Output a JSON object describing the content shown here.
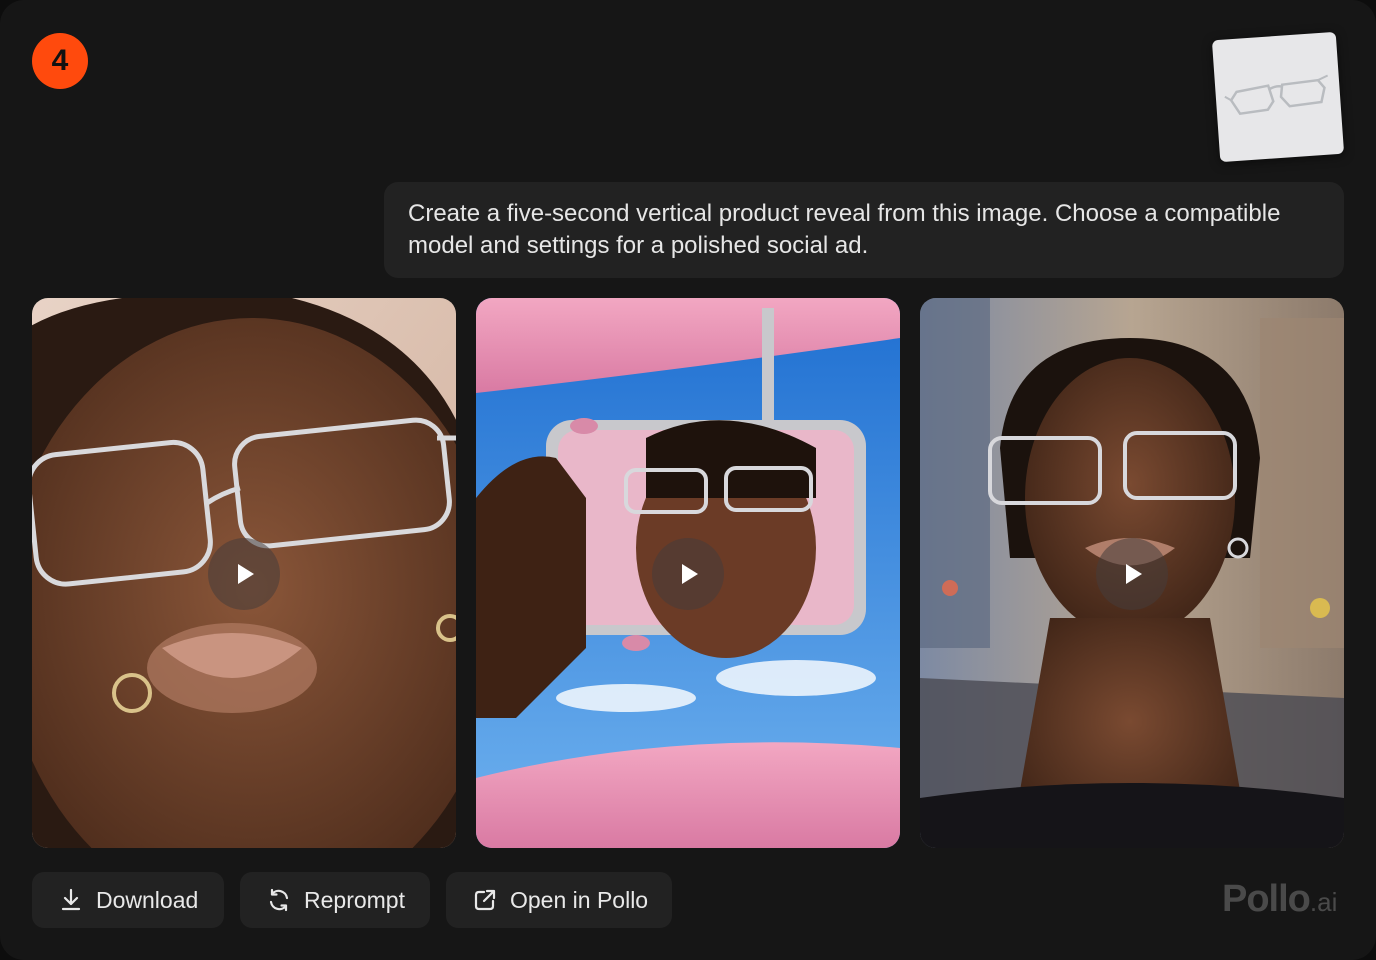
{
  "step": {
    "number": "4",
    "color": "#ff4a0d"
  },
  "reference_image": {
    "icon": "eyeglasses-product-icon"
  },
  "prompt": {
    "text": "Create a five-second vertical product reveal from this image. Choose a compatible model and settings for a polished social ad."
  },
  "results": [
    {
      "name": "close-up-portrait-video",
      "icon": "play-icon"
    },
    {
      "name": "car-mirror-video",
      "icon": "play-icon"
    },
    {
      "name": "city-street-portrait-video",
      "icon": "play-icon"
    }
  ],
  "actions": {
    "download_label": "Download",
    "reprompt_label": "Reprompt",
    "open_label": "Open in Pollo"
  },
  "brand": {
    "name": "Pollo",
    "suffix": ".ai"
  }
}
